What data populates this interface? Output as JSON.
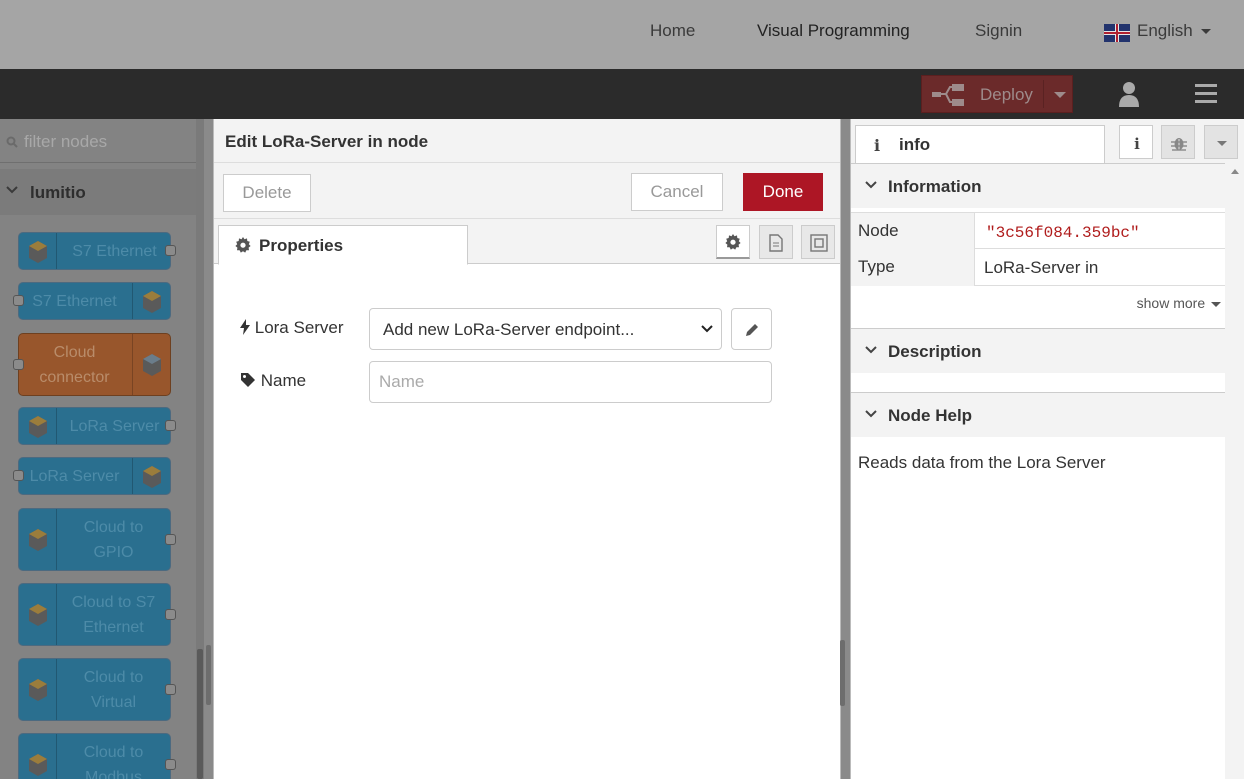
{
  "topnav": {
    "home": "Home",
    "visual_programming": "Visual Programming",
    "signin": "Signin",
    "language": "English"
  },
  "header": {
    "deploy_label": "Deploy"
  },
  "palette": {
    "filter_placeholder": "filter nodes",
    "category": "lumitio",
    "nodes": [
      {
        "label": "S7 Ethernet",
        "color": "#2a6f8f"
      },
      {
        "label": "S7 Ethernet",
        "color": "#2a6f8f"
      },
      {
        "label": "Cloud connector",
        "color": "#98562c"
      },
      {
        "label": "LoRa Server",
        "color": "#2a6f8f"
      },
      {
        "label": "LoRa Server",
        "color": "#2a6f8f"
      },
      {
        "label": "Cloud to GPIO",
        "color": "#2a6f8f"
      },
      {
        "label": "Cloud to S7 Ethernet",
        "color": "#2a6f8f"
      },
      {
        "label": "Cloud to Virtual",
        "color": "#2a6f8f"
      },
      {
        "label": "Cloud to Modbus",
        "color": "#2a6f8f"
      }
    ]
  },
  "editor": {
    "title": "Edit LoRa-Server in node",
    "delete_label": "Delete",
    "cancel_label": "Cancel",
    "done_label": "Done",
    "properties_tab": "Properties",
    "lora_server_label": "Lora Server",
    "lora_server_value": "Add new LoRa-Server endpoint...",
    "name_label": "Name",
    "name_placeholder": "Name",
    "accent_color": "#ad1625"
  },
  "sidebar": {
    "tab_label": "info",
    "information_header": "Information",
    "node_key": "Node",
    "node_value": "\"3c56f084.359bc\"",
    "type_key": "Type",
    "type_value": "LoRa-Server in",
    "show_more": "show more",
    "description_header": "Description",
    "node_help_header": "Node Help",
    "help_text": "Reads data from the Lora Server"
  }
}
